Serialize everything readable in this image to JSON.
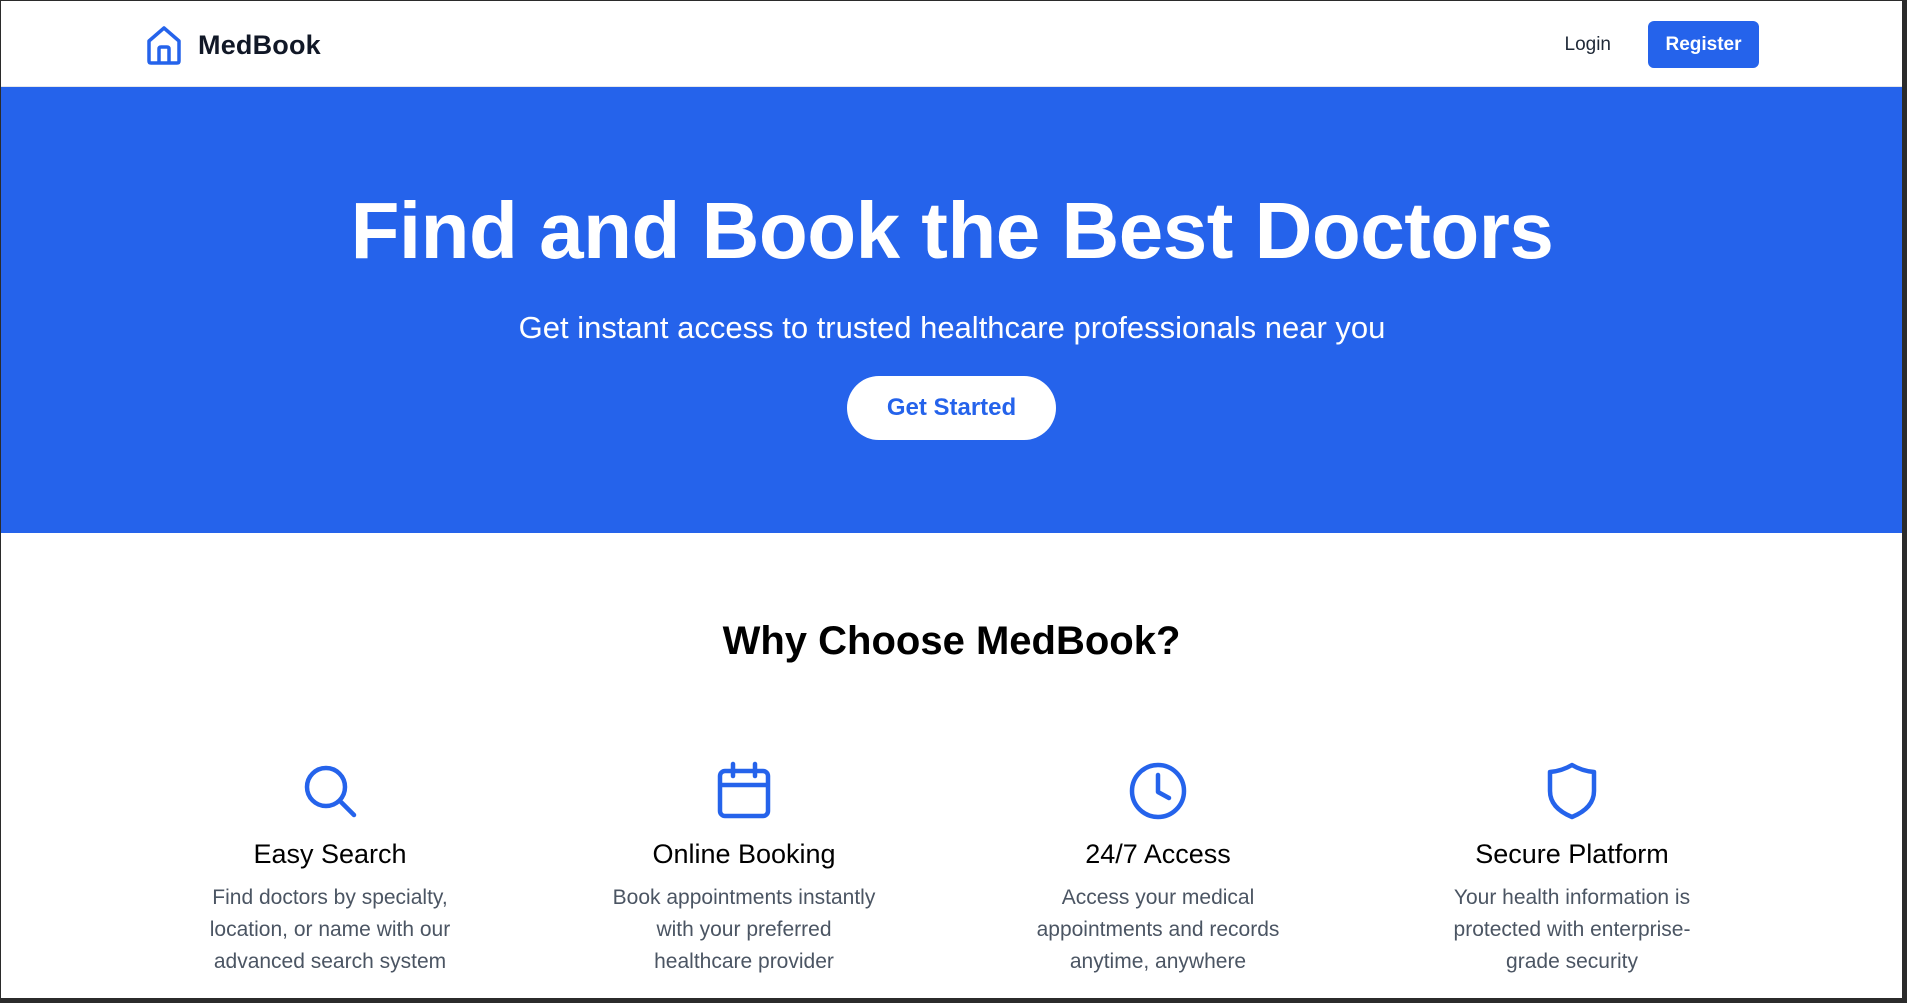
{
  "header": {
    "brand": "MedBook",
    "login_label": "Login",
    "register_label": "Register"
  },
  "hero": {
    "title": "Find and Book the Best Doctors",
    "subtitle": "Get instant access to trusted healthcare professionals near you",
    "cta_label": "Get Started"
  },
  "features": {
    "title": "Why Choose MedBook?",
    "items": [
      {
        "icon": "search-icon",
        "title": "Easy Search",
        "description": "Find doctors by specialty, location, or name with our advanced search system"
      },
      {
        "icon": "calendar-icon",
        "title": "Online Booking",
        "description": "Book appointments instantly with your preferred healthcare provider"
      },
      {
        "icon": "clock-icon",
        "title": "24/7 Access",
        "description": "Access your medical appointments and records anytime, anywhere"
      },
      {
        "icon": "shield-icon",
        "title": "Secure Platform",
        "description": "Your health information is protected with enterprise-grade security"
      }
    ]
  },
  "colors": {
    "primary": "#2563eb",
    "text_dark": "#111827",
    "text_muted": "#4b5563",
    "background": "#ffffff"
  }
}
